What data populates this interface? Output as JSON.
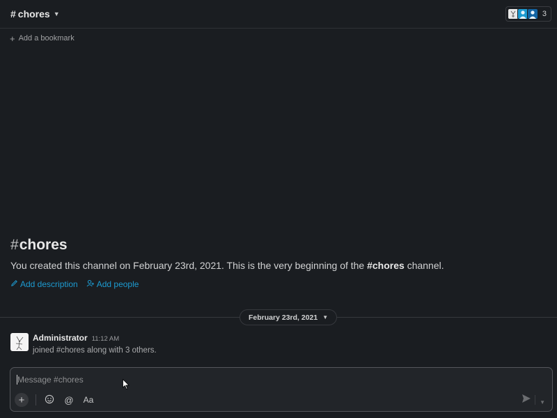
{
  "header": {
    "channel_hash": "#",
    "channel_name": "chores",
    "member_count": "3"
  },
  "bookmark": {
    "label": "Add a bookmark"
  },
  "intro": {
    "hash": "#",
    "title": "chores",
    "text_before": "You created this channel on February 23rd, 2021. This is the very beginning of the ",
    "text_channel": "#chores",
    "text_after": " channel.",
    "add_description": "Add description",
    "add_people": "Add people"
  },
  "divider": {
    "date": "February 23rd, 2021"
  },
  "message": {
    "author": "Administrator",
    "time": "11:12 AM",
    "text": "joined #chores along with 3 others."
  },
  "composer": {
    "placeholder": "Message #chores",
    "format_label": "Aa"
  },
  "icons": {
    "bookmark_add": "plus-icon",
    "description": "pencil-icon",
    "people": "add-person-icon",
    "emoji": "emoji-icon",
    "mention": "at-icon",
    "send": "send-icon"
  },
  "colors": {
    "background": "#1a1d21",
    "link": "#1d9bd1",
    "composer_border": "#55575c"
  }
}
